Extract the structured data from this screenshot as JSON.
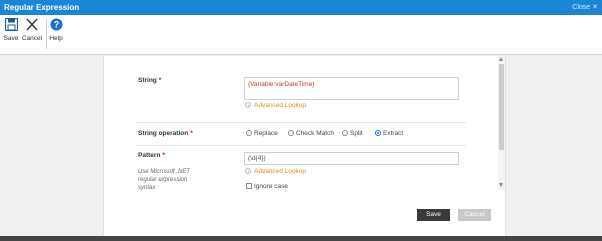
{
  "window": {
    "title": "Regular Expression",
    "close_label": "Close",
    "close_glyph": "✕"
  },
  "toolbar": {
    "save_label": "Save",
    "cancel_label": "Cancel",
    "help_label": "Help"
  },
  "form": {
    "string": {
      "label": "String",
      "required_mark": "*",
      "value": "{Variable:varDateTime}",
      "lookup_label": "Advanced Lookup"
    },
    "string_operation": {
      "label": "String operation",
      "required_mark": "*",
      "options": [
        "Replace",
        "Check Match",
        "Split",
        "Extract"
      ],
      "selected": "Extract"
    },
    "pattern": {
      "label": "Pattern",
      "required_mark": "*",
      "hint": "Use Microsoft .NET regular expression syntax",
      "value": "(\\d{4})",
      "lookup_label": "Advanced Lookup",
      "ignore_case_label": "Ignore case",
      "ignore_case_checked": false
    }
  },
  "footer": {
    "save_label": "Save",
    "cancel_label": "Cancel"
  },
  "colors": {
    "titlebar": "#1b86d6",
    "accent_orange": "#e08a1e",
    "required_red": "#dd0000",
    "save_button": "#3a3a3a",
    "cancel_button": "#c8c8c8"
  }
}
